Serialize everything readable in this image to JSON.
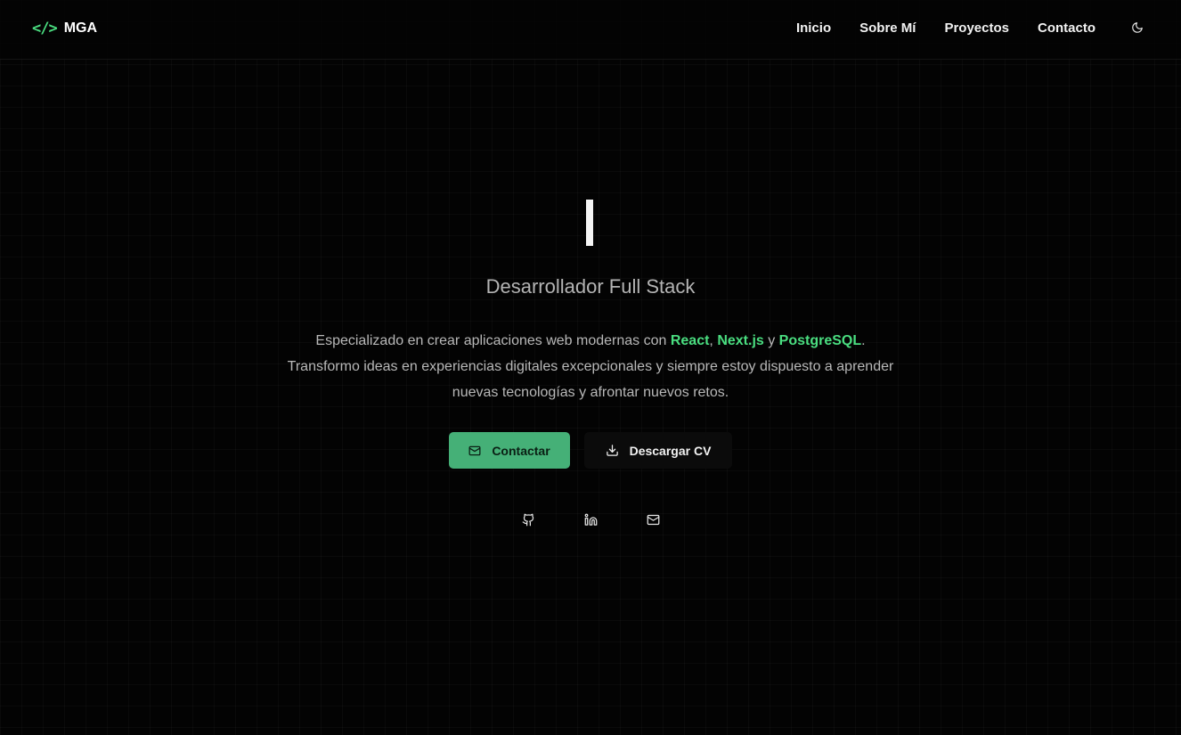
{
  "nav": {
    "logo_icon": "</>",
    "logo_text": "MGA",
    "links": [
      "Inicio",
      "Sobre Mí",
      "Proyectos",
      "Contacto"
    ],
    "theme_icon": "moon-icon"
  },
  "hero": {
    "subtitle": "Desarrollador Full Stack",
    "description": {
      "p1": "Especializado en crear aplicaciones web modernas con ",
      "react": "React",
      "comma": ", ",
      "next": "Next.js",
      "y": " y ",
      "postgres": "PostgreSQL",
      "p2": ". Transformo ideas en experiencias digitales excepcionales y siempre estoy dispuesto a aprender nuevas tecnologías y afrontar nuevos retos."
    },
    "buttons": {
      "contact_label": "Contactar",
      "contact_icon": "mail-icon",
      "cv_label": "Descargar CV",
      "cv_icon": "download-icon"
    },
    "socials": [
      "github-icon",
      "linkedin-icon",
      "mail-icon"
    ]
  },
  "colors": {
    "accent": "#4ade80",
    "button_primary": "#45b077",
    "background": "#030303"
  }
}
